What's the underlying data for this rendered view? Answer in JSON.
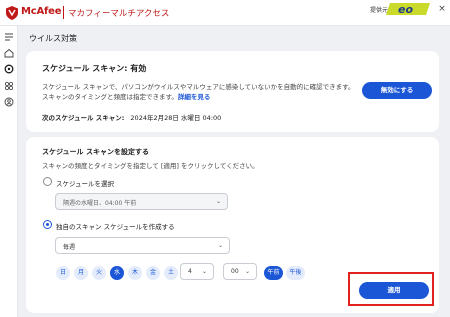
{
  "app": {
    "brand": "McAfee",
    "product": "マカフィーマルチアクセス",
    "provider_label": "提供元",
    "provider_logo_text": "eo",
    "close_glyph": "×",
    "brand_color": "#c01818"
  },
  "sidebar": {
    "items": [
      {
        "icon": "menu-icon"
      },
      {
        "icon": "home-icon"
      },
      {
        "icon": "protection-icon"
      },
      {
        "icon": "apps-icon"
      },
      {
        "icon": "privacy-icon"
      }
    ]
  },
  "page": {
    "title": "ウイルス対策"
  },
  "scheduled_scan": {
    "heading": "スケジュール スキャン: 有効",
    "description": "スケジュール スキャンで、パソコンがウイルスやマルウェアに感染していないかを自動的に確認できます。 スキャンのタイミングと頻度は指定できます。",
    "details_link": "詳細を見る",
    "next_scan_label": "次のスケジュール スキャン:",
    "next_scan_value": "2024年2月28日 水曜日 04:00",
    "disable_button": "無効にする"
  },
  "settings": {
    "heading": "スケジュール スキャンを設定する",
    "description": "スキャンの頻度とタイミングを指定して [適用] をクリックしてください。",
    "option_schedule_label": "スケジュールを選択",
    "option_schedule_selected": false,
    "schedule_select_value": "隔週の水曜日、04:00 午前",
    "option_custom_label": "独自のスキャン スケジュールを作成する",
    "option_custom_selected": true,
    "frequency_select_value": "毎週",
    "days": [
      {
        "label": "日",
        "active": false
      },
      {
        "label": "月",
        "active": false
      },
      {
        "label": "火",
        "active": false
      },
      {
        "label": "水",
        "active": true
      },
      {
        "label": "木",
        "active": false
      },
      {
        "label": "金",
        "active": false
      },
      {
        "label": "土",
        "active": false
      }
    ],
    "hour_value": "4",
    "minute_value": "00",
    "am_label": "午前",
    "pm_label": "午後",
    "am_active": true,
    "apply_button": "適用",
    "accent_color": "#1a56d6",
    "highlight_color": "#e0231c"
  }
}
